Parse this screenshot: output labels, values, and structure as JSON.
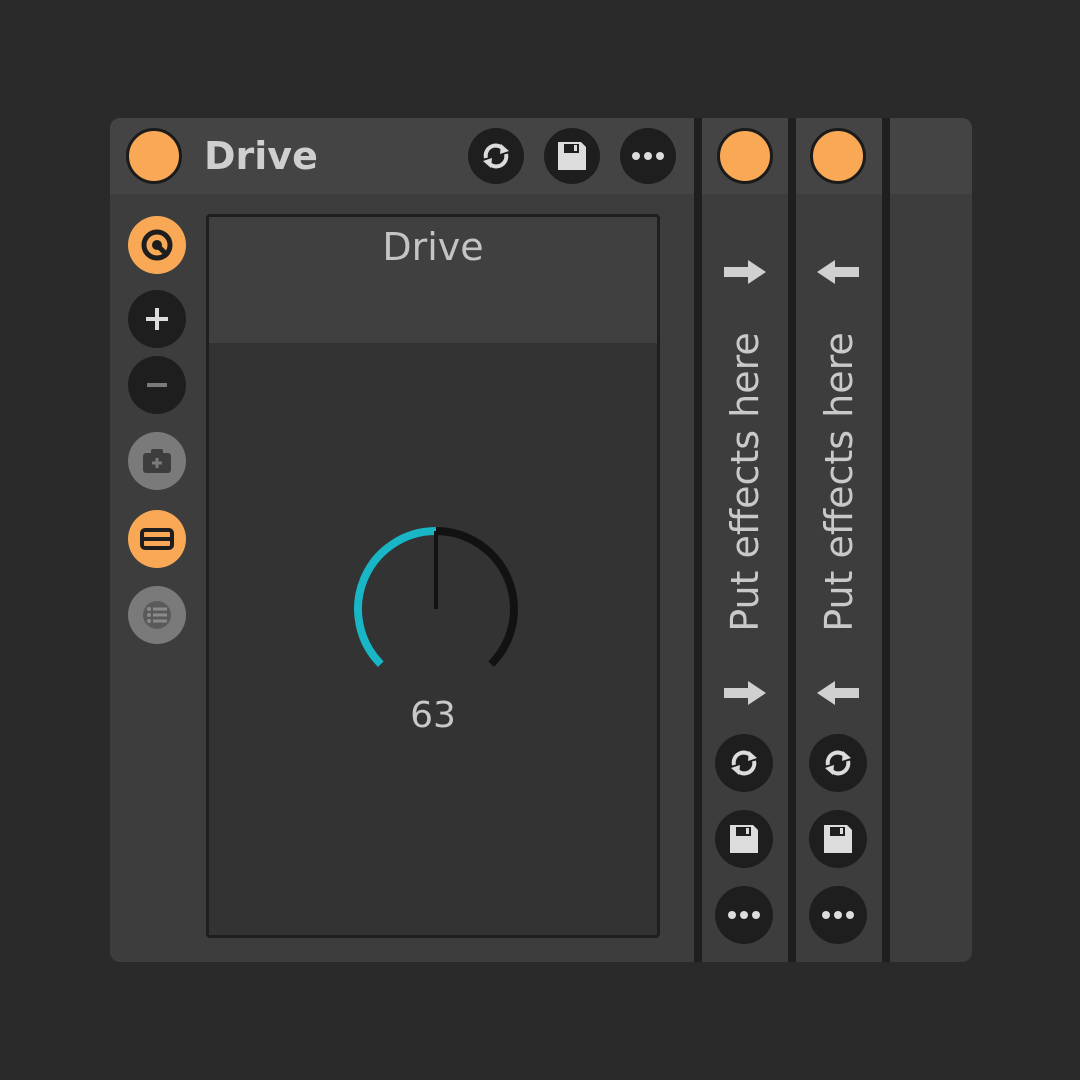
{
  "rack": {
    "title": "Drive",
    "device": {
      "name": "Drive",
      "knob_value": "63",
      "knob_level": 0.5
    },
    "chains": [
      {
        "label": "Put effects here"
      },
      {
        "label": "Put effects here"
      }
    ]
  },
  "colors": {
    "accent": "#f9a955",
    "knob_arc": "#19b6c6",
    "panel": "#3d3d3d",
    "background": "#2a2a2a"
  },
  "icons": [
    "power-led",
    "refresh-icon",
    "save-icon",
    "more-icon",
    "macro-icon",
    "plus-icon",
    "minus-icon",
    "snapshot-icon",
    "collapse-icon",
    "list-icon",
    "arrow-right-icon",
    "arrow-left-icon"
  ]
}
